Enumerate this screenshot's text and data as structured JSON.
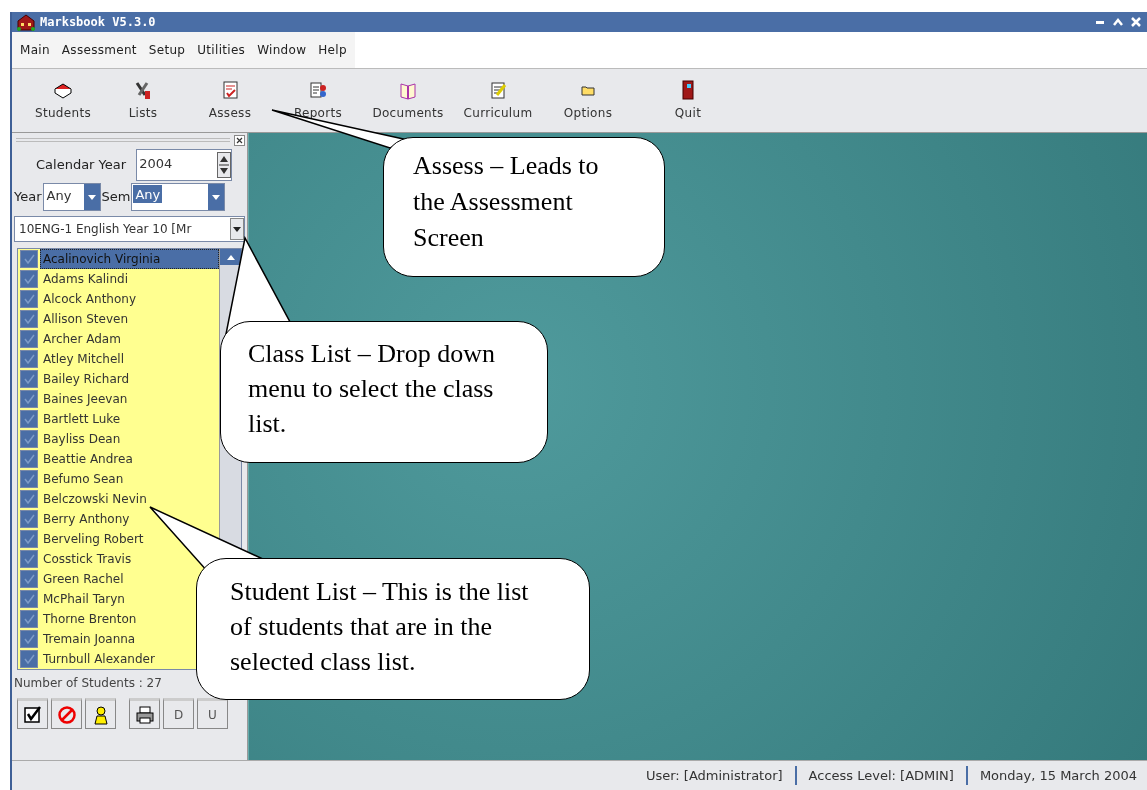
{
  "window": {
    "title": "Marksbook V5.3.0"
  },
  "menu": [
    "Main",
    "Assessment",
    "Setup",
    "Utilities",
    "Window",
    "Help"
  ],
  "toolbar": [
    {
      "label": "Students",
      "kind": "students"
    },
    {
      "label": "Lists",
      "kind": "lists"
    },
    {
      "label": "Assess",
      "kind": "assess"
    },
    {
      "label": "Reports",
      "kind": "reports"
    },
    {
      "label": "Documents",
      "kind": "documents"
    },
    {
      "label": "Curriculum",
      "kind": "curriculum"
    },
    {
      "label": "Options",
      "kind": "options"
    },
    {
      "label": "Quit",
      "kind": "quit"
    }
  ],
  "panel": {
    "calendar_year_label": "Calendar Year",
    "calendar_year": "2004",
    "year_label": "Year",
    "year": "Any",
    "sem_label": "Sem",
    "sem": "Any",
    "class": "10ENG-1 English Year 10 [Mr",
    "students": [
      {
        "name": "Acalinovich Virginia",
        "selected": true,
        "checked": true
      },
      {
        "name": "Adams Kalindi",
        "selected": false,
        "checked": true
      },
      {
        "name": "Alcock Anthony",
        "selected": false,
        "checked": true
      },
      {
        "name": "Allison Steven",
        "selected": false,
        "checked": true
      },
      {
        "name": "Archer Adam",
        "selected": false,
        "checked": true
      },
      {
        "name": "Atley Mitchell",
        "selected": false,
        "checked": true
      },
      {
        "name": "Bailey Richard",
        "selected": false,
        "checked": true
      },
      {
        "name": "Baines Jeevan",
        "selected": false,
        "checked": true
      },
      {
        "name": "Bartlett Luke",
        "selected": false,
        "checked": true
      },
      {
        "name": "Bayliss Dean",
        "selected": false,
        "checked": true
      },
      {
        "name": "Beattie Andrea",
        "selected": false,
        "checked": true
      },
      {
        "name": "Befumo Sean",
        "selected": false,
        "checked": true
      },
      {
        "name": "Belczowski Nevin",
        "selected": false,
        "checked": true
      },
      {
        "name": "Berry Anthony",
        "selected": false,
        "checked": true
      },
      {
        "name": "Berveling Robert",
        "selected": false,
        "checked": true
      },
      {
        "name": "Cosstick Travis",
        "selected": false,
        "checked": true
      },
      {
        "name": "Green Rachel",
        "selected": false,
        "checked": true
      },
      {
        "name": "McPhail Taryn",
        "selected": false,
        "checked": true
      },
      {
        "name": "Thorne Brenton",
        "selected": false,
        "checked": true
      },
      {
        "name": "Tremain Joanna",
        "selected": false,
        "checked": true
      },
      {
        "name": "Turnbull Alexander",
        "selected": false,
        "checked": true
      }
    ],
    "count": "Number of Students : 27",
    "buttons": [
      {
        "kind": "check"
      },
      {
        "kind": "cancel"
      },
      {
        "kind": "person"
      },
      {
        "kind": "print"
      },
      {
        "kind": "text",
        "label": "D"
      },
      {
        "kind": "text",
        "label": "U"
      }
    ]
  },
  "status_bar": [
    "User: [Administrator]",
    "Access Level: [ADMIN]",
    "Monday, 15 March 2004"
  ],
  "callouts": [
    "Assess – Leads to the Assessment Screen",
    "Class List – Drop down menu to select the class list.",
    "Student List – This is the list of students that are in the selected class list."
  ]
}
